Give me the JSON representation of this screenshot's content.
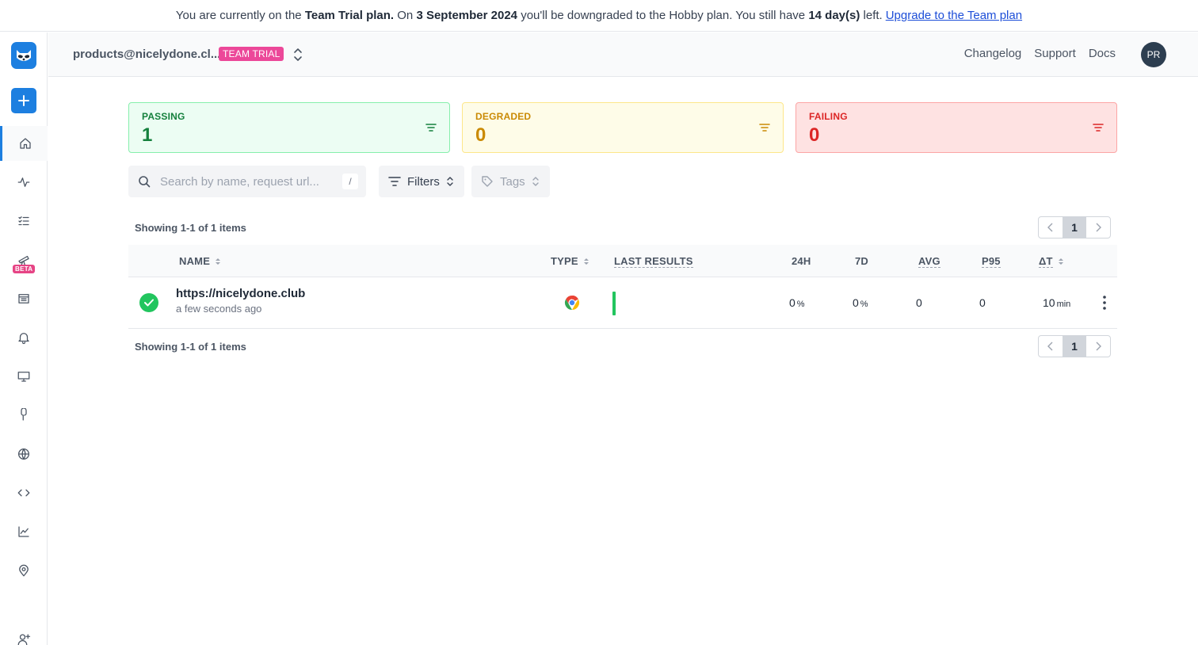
{
  "banner": {
    "part1": "You are currently on the",
    "plan": "Team Trial plan.",
    "part2": "On",
    "date": "3 September 2024",
    "part3": "you'll be downgraded to the Hobby plan. You still have",
    "days": "14 day(s)",
    "part4": "left.",
    "link": "Upgrade to the Team plan"
  },
  "sidebar": {
    "beta_label": "BETA",
    "items": [
      "home",
      "activity",
      "checks-list",
      "telescope",
      "list-details",
      "alerts",
      "monitor",
      "tools",
      "globe",
      "code",
      "chart",
      "location",
      "invite-user"
    ]
  },
  "header": {
    "account": "products@nicelydone.cl...",
    "badge": "TEAM TRIAL",
    "links": [
      "Changelog",
      "Support",
      "Docs"
    ],
    "avatar": "PR"
  },
  "summary": {
    "passing": {
      "label": "PASSING",
      "count": "1"
    },
    "degraded": {
      "label": "DEGRADED",
      "count": "0"
    },
    "failing": {
      "label": "FAILING",
      "count": "0"
    }
  },
  "search": {
    "placeholder": "Search by name, request url...",
    "shortcut": "/"
  },
  "filters": {
    "filters_label": "Filters",
    "tags_label": "Tags"
  },
  "pagination": {
    "showing": "Showing 1-1 of 1 items",
    "page": "1"
  },
  "table": {
    "headers": {
      "name": "NAME",
      "type": "TYPE",
      "last_results": "LAST RESULTS",
      "h24": "24H",
      "d7": "7D",
      "avg": "AVG",
      "p95": "P95",
      "delta": "ΔT"
    },
    "rows": [
      {
        "name": "https://nicelydone.club",
        "time": "a few seconds ago",
        "h24": "0",
        "h24_unit": "%",
        "d7": "0",
        "d7_unit": "%",
        "avg": "0",
        "p95": "0",
        "delta": "10",
        "delta_unit": "min"
      }
    ]
  },
  "colors": {
    "accent": "#1d7fe0",
    "passing": "#15803d",
    "degraded": "#ca8a04",
    "failing": "#dc2626",
    "badge": "#ec4899"
  }
}
